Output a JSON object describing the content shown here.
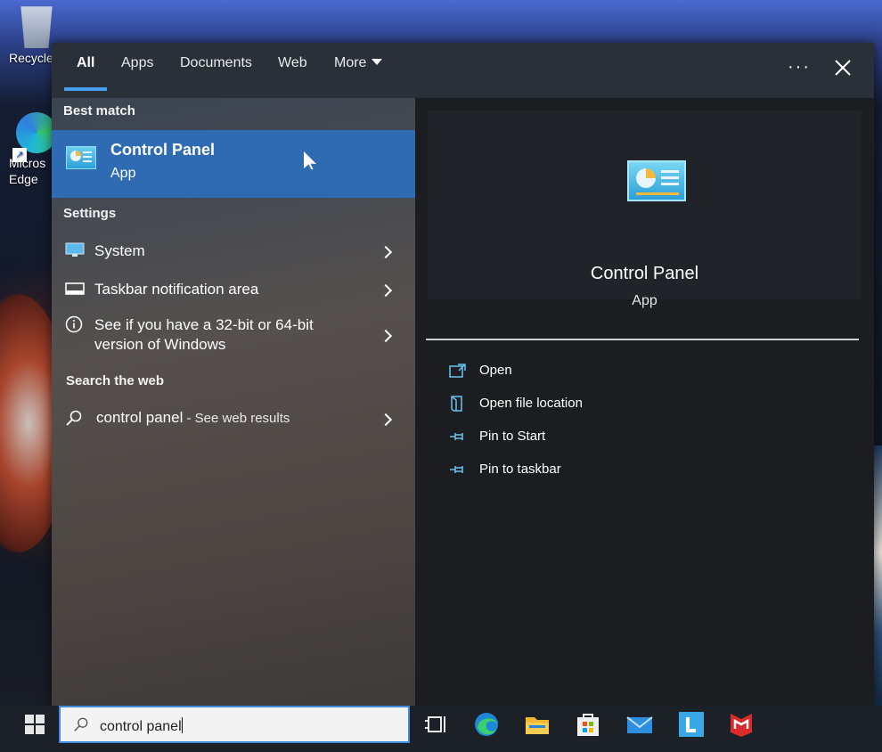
{
  "desktop": {
    "icons": [
      {
        "label": "Recycle"
      },
      {
        "label": "Micros Edge"
      }
    ]
  },
  "tabs": [
    {
      "label": "All"
    },
    {
      "label": "Apps"
    },
    {
      "label": "Documents"
    },
    {
      "label": "Web"
    },
    {
      "label": "More"
    }
  ],
  "toolbar": {
    "ellipsis": "···"
  },
  "results": {
    "best_match_heading": "Best match",
    "best_match": {
      "title": "Control Panel",
      "subtitle": "App"
    },
    "settings_heading": "Settings",
    "settings": [
      {
        "label": "System",
        "icon": "monitor-icon"
      },
      {
        "label": "Taskbar notification area",
        "icon": "taskbar-icon"
      },
      {
        "label": "See if you have a 32-bit or 64-bit version of Windows",
        "icon": "info-icon"
      }
    ],
    "web_heading": "Search the web",
    "web": {
      "query": "control panel",
      "suffix": " - See web results"
    }
  },
  "preview": {
    "title": "Control Panel",
    "subtitle": "App",
    "actions": [
      {
        "label": "Open",
        "icon": "open-icon"
      },
      {
        "label": "Open file location",
        "icon": "file-location-icon"
      },
      {
        "label": "Pin to Start",
        "icon": "pin-icon"
      },
      {
        "label": "Pin to taskbar",
        "icon": "pin-icon"
      }
    ]
  },
  "taskbar": {
    "search_value": "control panel",
    "apps": [
      "task-view-icon",
      "edge-icon",
      "file-explorer-icon",
      "store-icon",
      "mail-icon",
      "l-app-icon",
      "mcafee-icon"
    ]
  },
  "colors": {
    "accent": "#2f6bb3",
    "tab_underline": "#4aa0f0"
  }
}
